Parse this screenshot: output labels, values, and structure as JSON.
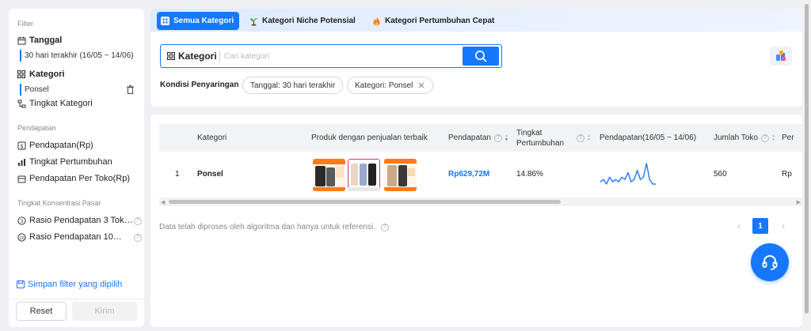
{
  "sidebar": {
    "filter_title": "Filter",
    "tanggal_label": "Tanggal",
    "tanggal_value": "30 hari terakhir (16/05 ~ 14/06)",
    "kategori_label": "Kategori",
    "kategori_value": "Ponsel",
    "tingkat_kategori_label": "Tingkat Kategori",
    "pendapatan_section": "Pendapatan",
    "pendapatan_items": [
      "Pendapatan(Rp)",
      "Tingkat Pertumbuhan",
      "Pendapatan Per Toko(Rp)"
    ],
    "konsentrasi_section": "Tingkat Konsentrasi Pasar",
    "konsentrasi_items": [
      "Rasio Pendapatan 3 Tok…",
      "Rasio Pendapatan 10…"
    ],
    "save_filter_label": "Simpan filter yang dipilih",
    "reset_label": "Reset",
    "kirim_label": "Kirim"
  },
  "tabs": [
    {
      "label": "Semua Kategori",
      "active": true,
      "icon": "grid-icon"
    },
    {
      "label": "Kategori Niche Potensial",
      "active": false,
      "icon": "sprout-icon"
    },
    {
      "label": "Kategori Pertumbuhan Cepat",
      "active": false,
      "icon": "flame-icon"
    }
  ],
  "search": {
    "label": "Kategori",
    "placeholder": "Cari kategori",
    "value": ""
  },
  "conditions": {
    "label": "Kondisi Penyaringan",
    "chips": [
      "Tanggal: 30 hari terakhir",
      "Kategori: Ponsel"
    ]
  },
  "table": {
    "headers": {
      "kategori": "Kategori",
      "produk": "Produk dengan penjualan terbaik",
      "pendapatan": "Pendapatan",
      "tingkat": "Tingkat\nPertumbuhan",
      "trend": "Pendapatan(16/05 ~ 14/06)",
      "jumlah_toko": "Jumlah Toko",
      "more": "Per"
    },
    "rows": [
      {
        "rank": "1",
        "kategori": "Ponsel",
        "pendapatan": "Rp629,72M",
        "tingkat": "14.86%",
        "jumlah_toko": "560",
        "more": "Rp"
      }
    ],
    "sparkline": [
      2,
      3,
      1,
      4,
      2,
      3,
      2,
      4,
      3,
      6,
      2,
      3,
      7,
      3,
      4,
      10,
      3,
      1,
      1
    ]
  },
  "footer": {
    "note": "Data telah diproses oleh algoritma dan hanya untuk referensi.",
    "page": "1"
  },
  "colors": {
    "accent": "#1677ff"
  }
}
